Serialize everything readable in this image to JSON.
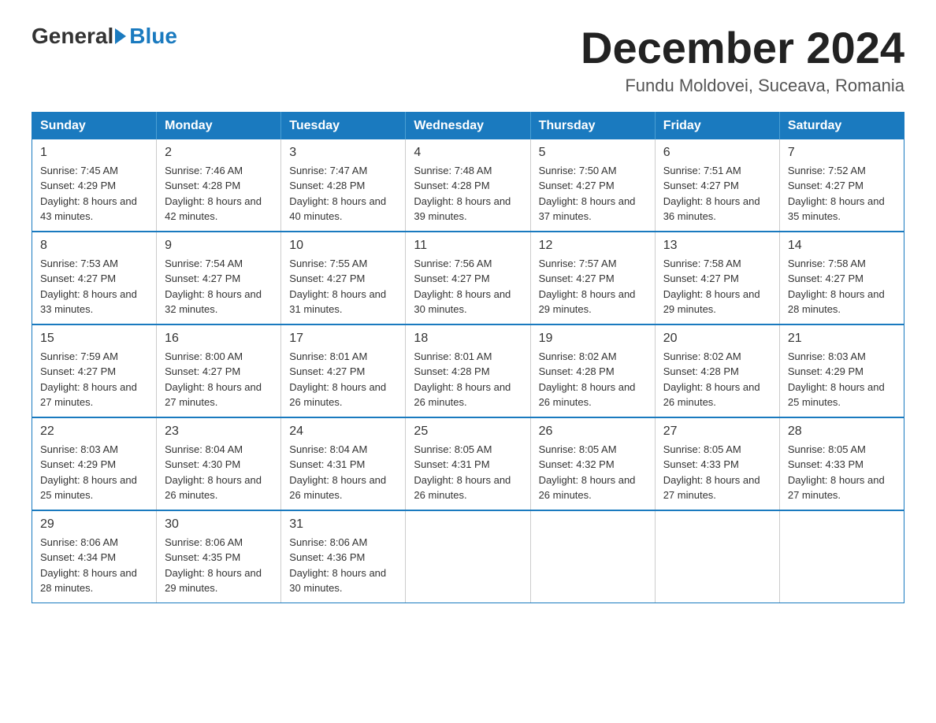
{
  "header": {
    "logo_general": "General",
    "logo_blue": "Blue",
    "month_title": "December 2024",
    "location": "Fundu Moldovei, Suceava, Romania"
  },
  "days_of_week": [
    "Sunday",
    "Monday",
    "Tuesday",
    "Wednesday",
    "Thursday",
    "Friday",
    "Saturday"
  ],
  "weeks": [
    [
      {
        "day": "1",
        "sunrise": "7:45 AM",
        "sunset": "4:29 PM",
        "daylight": "8 hours and 43 minutes."
      },
      {
        "day": "2",
        "sunrise": "7:46 AM",
        "sunset": "4:28 PM",
        "daylight": "8 hours and 42 minutes."
      },
      {
        "day": "3",
        "sunrise": "7:47 AM",
        "sunset": "4:28 PM",
        "daylight": "8 hours and 40 minutes."
      },
      {
        "day": "4",
        "sunrise": "7:48 AM",
        "sunset": "4:28 PM",
        "daylight": "8 hours and 39 minutes."
      },
      {
        "day": "5",
        "sunrise": "7:50 AM",
        "sunset": "4:27 PM",
        "daylight": "8 hours and 37 minutes."
      },
      {
        "day": "6",
        "sunrise": "7:51 AM",
        "sunset": "4:27 PM",
        "daylight": "8 hours and 36 minutes."
      },
      {
        "day": "7",
        "sunrise": "7:52 AM",
        "sunset": "4:27 PM",
        "daylight": "8 hours and 35 minutes."
      }
    ],
    [
      {
        "day": "8",
        "sunrise": "7:53 AM",
        "sunset": "4:27 PM",
        "daylight": "8 hours and 33 minutes."
      },
      {
        "day": "9",
        "sunrise": "7:54 AM",
        "sunset": "4:27 PM",
        "daylight": "8 hours and 32 minutes."
      },
      {
        "day": "10",
        "sunrise": "7:55 AM",
        "sunset": "4:27 PM",
        "daylight": "8 hours and 31 minutes."
      },
      {
        "day": "11",
        "sunrise": "7:56 AM",
        "sunset": "4:27 PM",
        "daylight": "8 hours and 30 minutes."
      },
      {
        "day": "12",
        "sunrise": "7:57 AM",
        "sunset": "4:27 PM",
        "daylight": "8 hours and 29 minutes."
      },
      {
        "day": "13",
        "sunrise": "7:58 AM",
        "sunset": "4:27 PM",
        "daylight": "8 hours and 29 minutes."
      },
      {
        "day": "14",
        "sunrise": "7:58 AM",
        "sunset": "4:27 PM",
        "daylight": "8 hours and 28 minutes."
      }
    ],
    [
      {
        "day": "15",
        "sunrise": "7:59 AM",
        "sunset": "4:27 PM",
        "daylight": "8 hours and 27 minutes."
      },
      {
        "day": "16",
        "sunrise": "8:00 AM",
        "sunset": "4:27 PM",
        "daylight": "8 hours and 27 minutes."
      },
      {
        "day": "17",
        "sunrise": "8:01 AM",
        "sunset": "4:27 PM",
        "daylight": "8 hours and 26 minutes."
      },
      {
        "day": "18",
        "sunrise": "8:01 AM",
        "sunset": "4:28 PM",
        "daylight": "8 hours and 26 minutes."
      },
      {
        "day": "19",
        "sunrise": "8:02 AM",
        "sunset": "4:28 PM",
        "daylight": "8 hours and 26 minutes."
      },
      {
        "day": "20",
        "sunrise": "8:02 AM",
        "sunset": "4:28 PM",
        "daylight": "8 hours and 26 minutes."
      },
      {
        "day": "21",
        "sunrise": "8:03 AM",
        "sunset": "4:29 PM",
        "daylight": "8 hours and 25 minutes."
      }
    ],
    [
      {
        "day": "22",
        "sunrise": "8:03 AM",
        "sunset": "4:29 PM",
        "daylight": "8 hours and 25 minutes."
      },
      {
        "day": "23",
        "sunrise": "8:04 AM",
        "sunset": "4:30 PM",
        "daylight": "8 hours and 26 minutes."
      },
      {
        "day": "24",
        "sunrise": "8:04 AM",
        "sunset": "4:31 PM",
        "daylight": "8 hours and 26 minutes."
      },
      {
        "day": "25",
        "sunrise": "8:05 AM",
        "sunset": "4:31 PM",
        "daylight": "8 hours and 26 minutes."
      },
      {
        "day": "26",
        "sunrise": "8:05 AM",
        "sunset": "4:32 PM",
        "daylight": "8 hours and 26 minutes."
      },
      {
        "day": "27",
        "sunrise": "8:05 AM",
        "sunset": "4:33 PM",
        "daylight": "8 hours and 27 minutes."
      },
      {
        "day": "28",
        "sunrise": "8:05 AM",
        "sunset": "4:33 PM",
        "daylight": "8 hours and 27 minutes."
      }
    ],
    [
      {
        "day": "29",
        "sunrise": "8:06 AM",
        "sunset": "4:34 PM",
        "daylight": "8 hours and 28 minutes."
      },
      {
        "day": "30",
        "sunrise": "8:06 AM",
        "sunset": "4:35 PM",
        "daylight": "8 hours and 29 minutes."
      },
      {
        "day": "31",
        "sunrise": "8:06 AM",
        "sunset": "4:36 PM",
        "daylight": "8 hours and 30 minutes."
      },
      null,
      null,
      null,
      null
    ]
  ]
}
